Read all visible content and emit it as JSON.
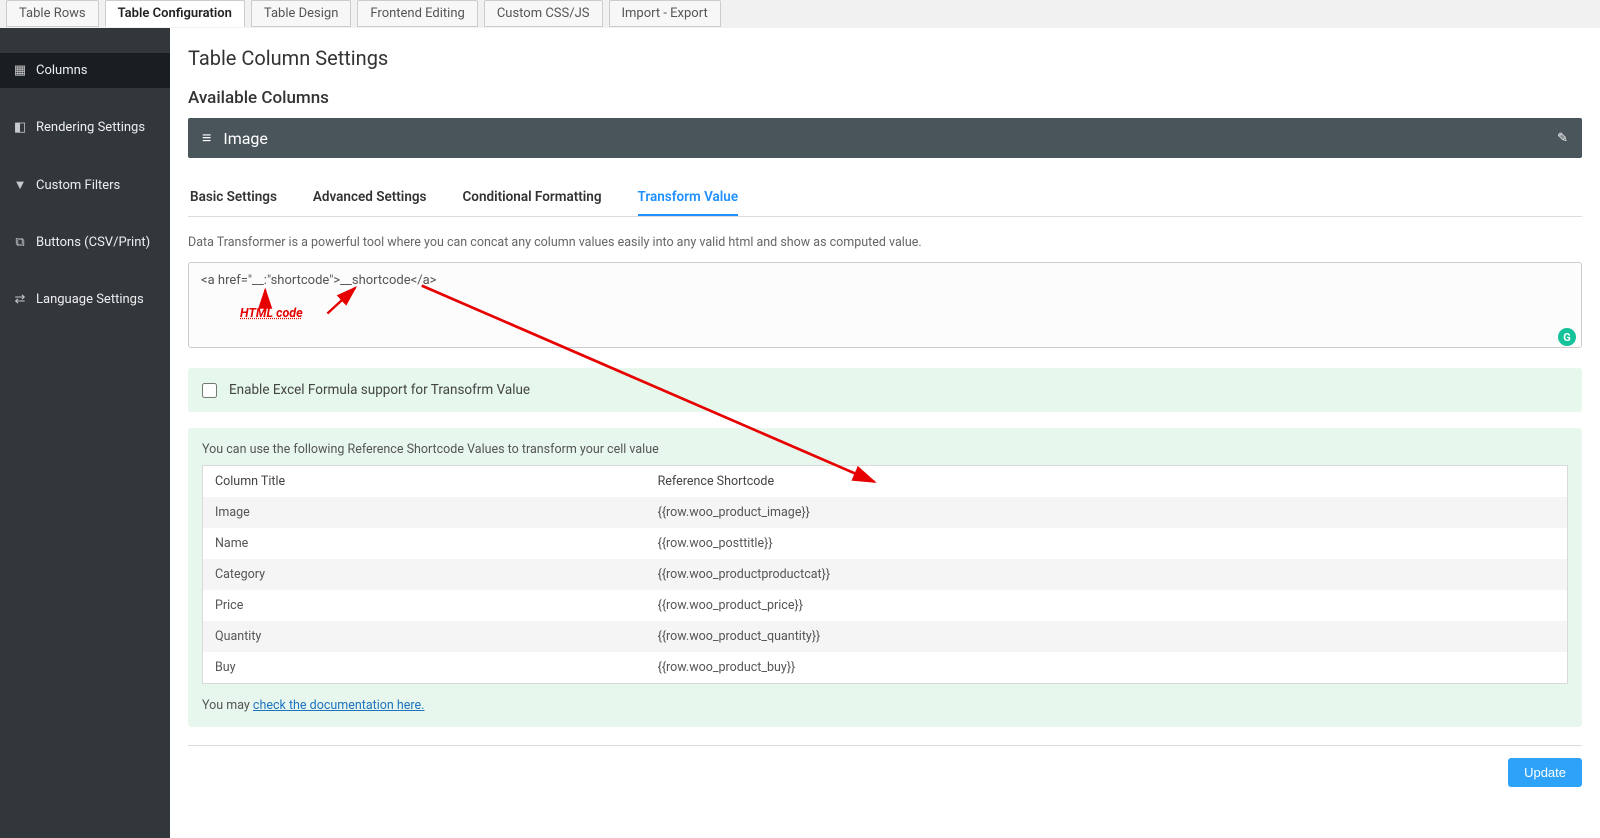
{
  "top_tabs": {
    "items": [
      {
        "label": "Table Rows"
      },
      {
        "label": "Table Configuration"
      },
      {
        "label": "Table Design"
      },
      {
        "label": "Frontend Editing"
      },
      {
        "label": "Custom CSS/JS"
      },
      {
        "label": "Import - Export"
      }
    ],
    "active_index": 1
  },
  "sidebar": {
    "items": [
      {
        "label": "Columns",
        "icon": "▦"
      },
      {
        "label": "Rendering Settings",
        "icon": "◧"
      },
      {
        "label": "Custom Filters",
        "icon": "▼"
      },
      {
        "label": "Buttons (CSV/Print)",
        "icon": "⧉"
      },
      {
        "label": "Language Settings",
        "icon": "⇄"
      }
    ],
    "active_index": 0
  },
  "page": {
    "title": "Table Column Settings",
    "available_label": "Available Columns"
  },
  "accordion": {
    "title": "Image"
  },
  "inner_tabs": {
    "items": [
      {
        "label": "Basic Settings"
      },
      {
        "label": "Advanced Settings"
      },
      {
        "label": "Conditional Formatting"
      },
      {
        "label": "Transform Value"
      }
    ],
    "active_index": 3
  },
  "transform": {
    "description": "Data Transformer is a powerful tool where you can concat any column values easily into any valid html and show as computed value.",
    "textarea_value": "<a href=\"__:\"shortcode\">__shortcode</a>",
    "annotation_label": "HTML code"
  },
  "excel_checkbox": {
    "label": "Enable Excel Formula support for Transofrm Value",
    "checked": false
  },
  "reference": {
    "intro": "You can use the following Reference Shortcode Values to transform your cell value",
    "th1": "Column Title",
    "th2": "Reference Shortcode",
    "rows": [
      {
        "col": "Image",
        "code": "{{row.woo_product_image}}"
      },
      {
        "col": "Name",
        "code": "{{row.woo_posttitle}}"
      },
      {
        "col": "Category",
        "code": "{{row.woo_productproductcat}}"
      },
      {
        "col": "Price",
        "code": "{{row.woo_product_price}}"
      },
      {
        "col": "Quantity",
        "code": "{{row.woo_product_quantity}}"
      },
      {
        "col": "Buy",
        "code": "{{row.woo_product_buy}}"
      }
    ],
    "doc_prefix": "You may ",
    "doc_link": "check the documentation here."
  },
  "footer": {
    "update_label": "Update"
  }
}
